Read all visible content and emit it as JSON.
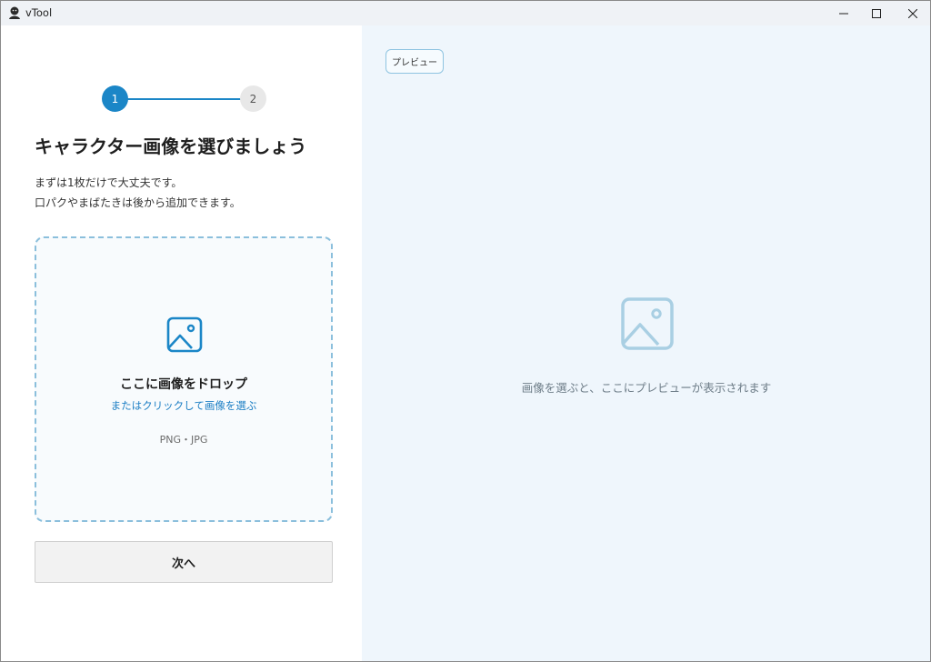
{
  "window": {
    "title": "vTool"
  },
  "steps": {
    "current": "1",
    "next": "2"
  },
  "main": {
    "headline": "キャラクター画像を選びましょう",
    "desc_line1": "まずは1枚だけで大丈夫です。",
    "desc_line2": "口パクやまばたきは後から追加できます。"
  },
  "dropzone": {
    "title": "ここに画像をドロップ",
    "link": "またはクリックして画像を選ぶ",
    "formats": "PNG・JPG",
    "icon": "image-icon"
  },
  "actions": {
    "next_label": "次へ"
  },
  "preview": {
    "tab_label": "プレビュー",
    "empty_text": "画像を選ぶと、ここにプレビューが表示されます",
    "icon": "image-icon"
  },
  "colors": {
    "accent": "#1b86c7",
    "preview_bg": "#eff6fc",
    "dropzone_border": "#8bbfdc"
  }
}
